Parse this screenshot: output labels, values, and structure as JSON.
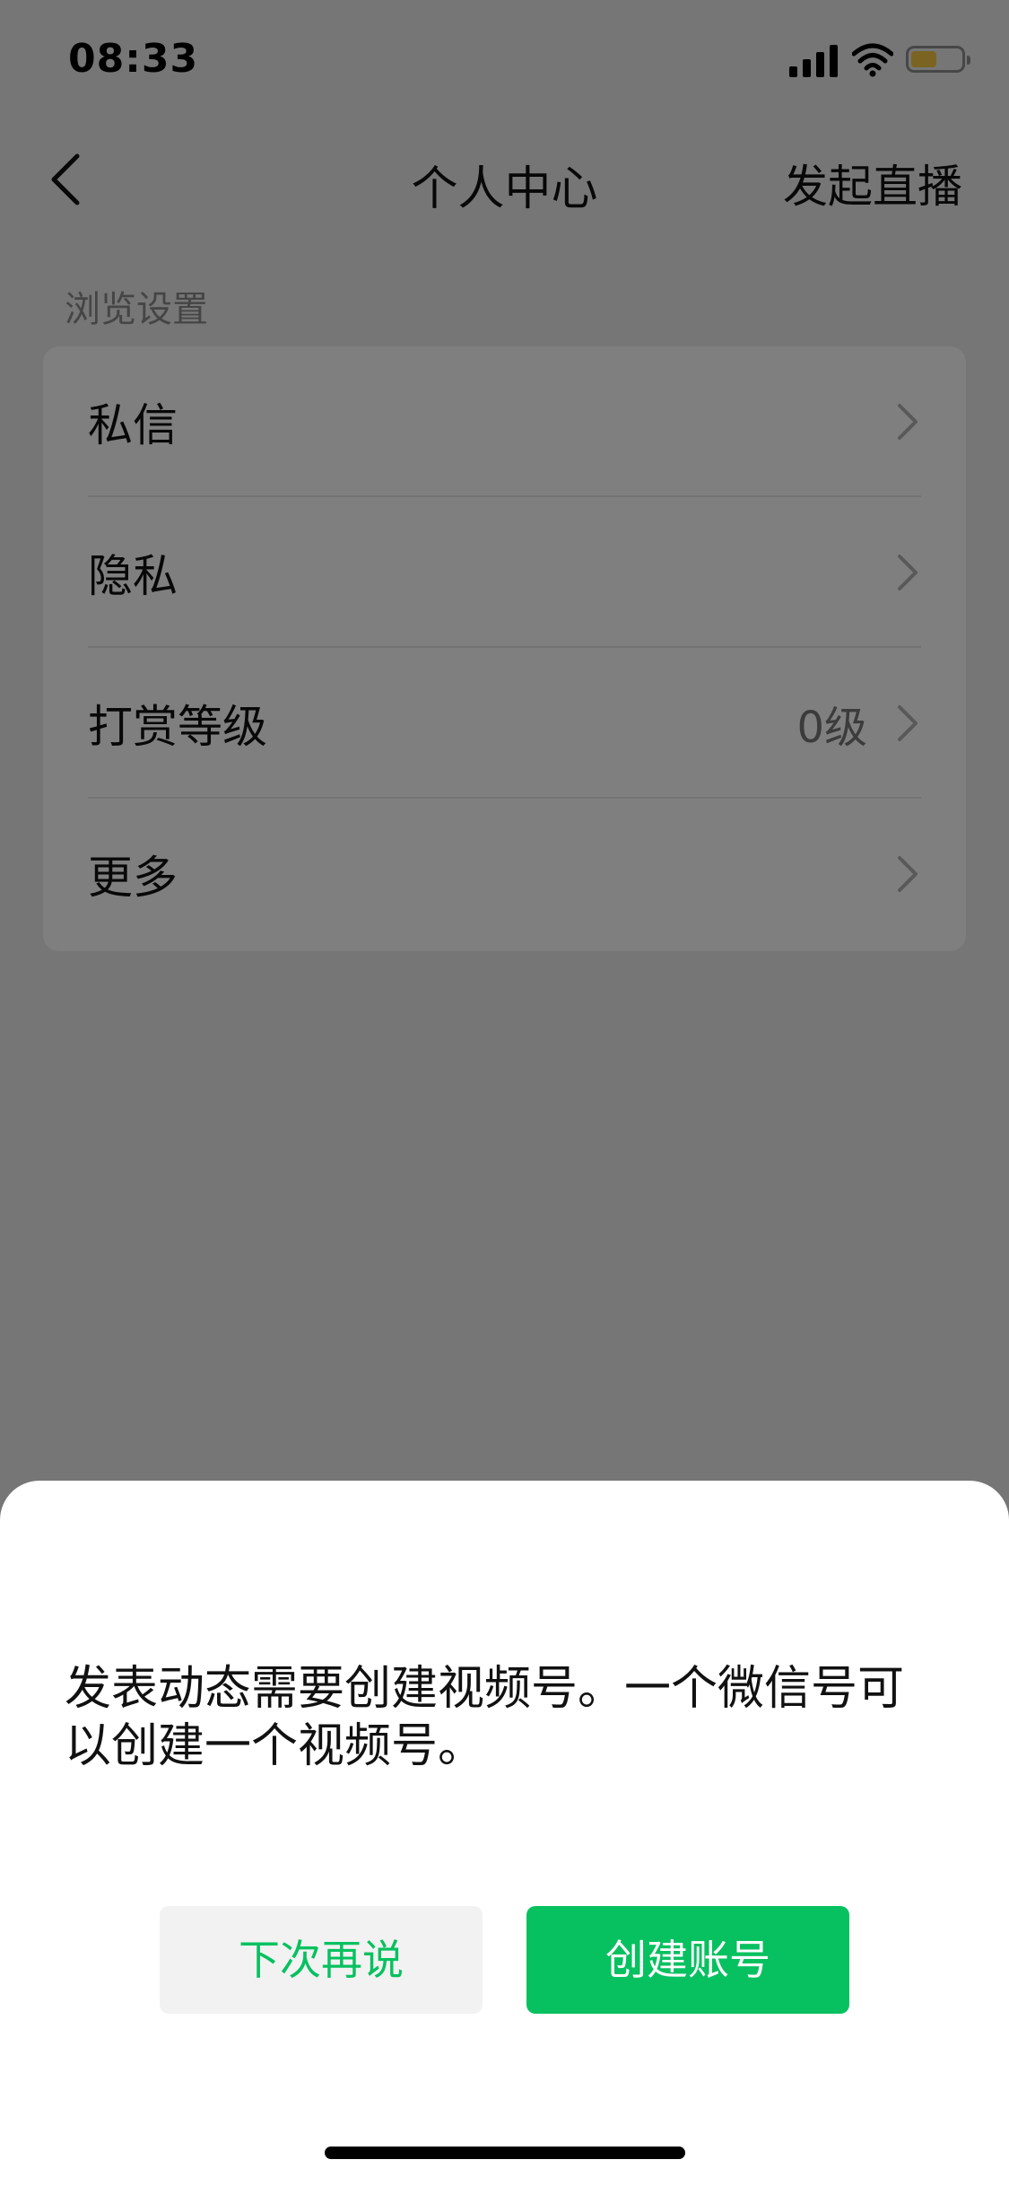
{
  "status_bar": {
    "time": "08:33",
    "icons": [
      "signal-icon",
      "wifi-icon",
      "battery-icon"
    ],
    "battery_color": "#f7c844"
  },
  "nav": {
    "back_icon": "chevron-left-icon",
    "title": "个人中心",
    "right_action": "发起直播"
  },
  "settings": {
    "section_label": "浏览设置",
    "items": [
      {
        "label": "私信",
        "value": ""
      },
      {
        "label": "隐私",
        "value": ""
      },
      {
        "label": "打赏等级",
        "value": "0级"
      },
      {
        "label": "更多",
        "value": ""
      }
    ]
  },
  "dialog": {
    "message": "发表动态需要创建视频号。一个微信号可以创建一个视频号。",
    "secondary_button": "下次再说",
    "primary_button": "创建账号",
    "accent_color": "#07c160"
  }
}
